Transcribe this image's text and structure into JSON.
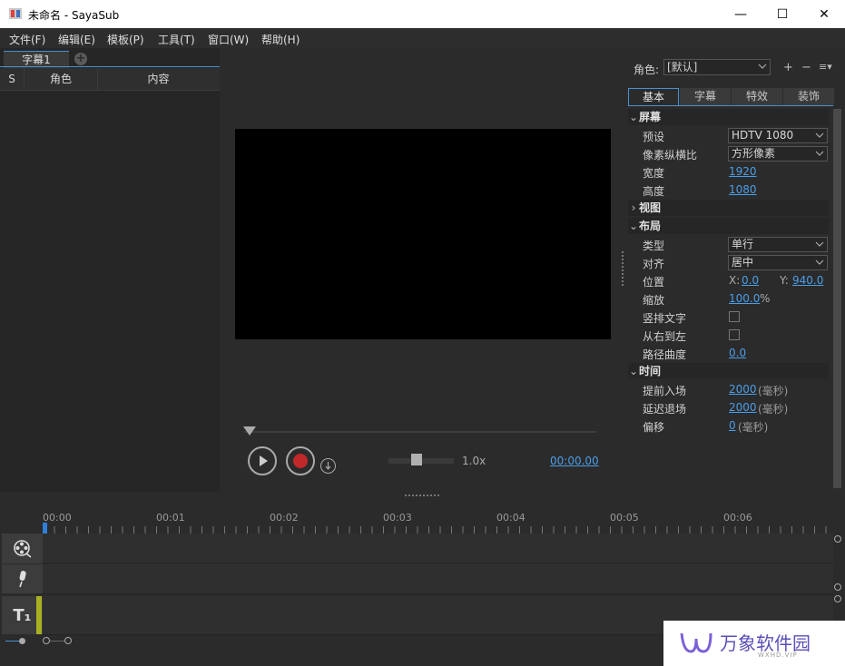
{
  "window": {
    "title": "未命名 - SayaSub",
    "minimize": "—",
    "maximize": "☐",
    "close": "✕"
  },
  "menu": [
    "文件(F)",
    "编辑(E)",
    "模板(P)",
    "工具(T)",
    "窗口(W)",
    "帮助(H)"
  ],
  "subtitle_panel": {
    "tab": "字幕1",
    "add_tab": "+",
    "columns": [
      "S",
      "角色",
      "内容"
    ]
  },
  "player": {
    "speed": "1.0x",
    "speed_fraction": 0.42,
    "timecode": "00:00.00"
  },
  "props": {
    "role_label": "角色:",
    "role_value": "[默认]",
    "tabs": [
      "基本",
      "字幕",
      "特效",
      "装饰"
    ],
    "screen": {
      "title": "屏幕",
      "preset_label": "预设",
      "preset_value": "HDTV 1080",
      "pixel_label": "像素纵横比",
      "pixel_value": "方形像素",
      "width_label": "宽度",
      "width_value": "1920",
      "height_label": "高度",
      "height_value": "1080"
    },
    "view": {
      "title": "视图"
    },
    "layout": {
      "title": "布局",
      "type_label": "类型",
      "type_value": "单行",
      "align_label": "对齐",
      "align_value": "居中",
      "pos_label": "位置",
      "x_label": "X:",
      "x_value": "0.0",
      "y_label": "Y:",
      "y_value": "940.0",
      "scale_label": "缩放",
      "scale_value": "100.0",
      "scale_unit": "%",
      "vertical_label": "竖排文字",
      "rtl_label": "从右到左",
      "curve_label": "路径曲度",
      "curve_value": "0.0"
    },
    "time": {
      "title": "时间",
      "lead_in_label": "提前入场",
      "lead_in_value": "2000",
      "lead_in_unit": "(毫秒)",
      "lead_out_label": "延迟退场",
      "lead_out_value": "2000",
      "lead_out_unit": "(毫秒)",
      "offset_label": "偏移",
      "offset_value": "0",
      "offset_unit": "(毫秒)"
    }
  },
  "timeline": {
    "ticks": [
      "00:00",
      "00:01",
      "00:02",
      "00:03",
      "00:04",
      "00:05",
      "00:06"
    ],
    "text_track_label": "T₁"
  },
  "watermark": {
    "brand": "万象软件园",
    "sub": "WXHD.VIP"
  }
}
